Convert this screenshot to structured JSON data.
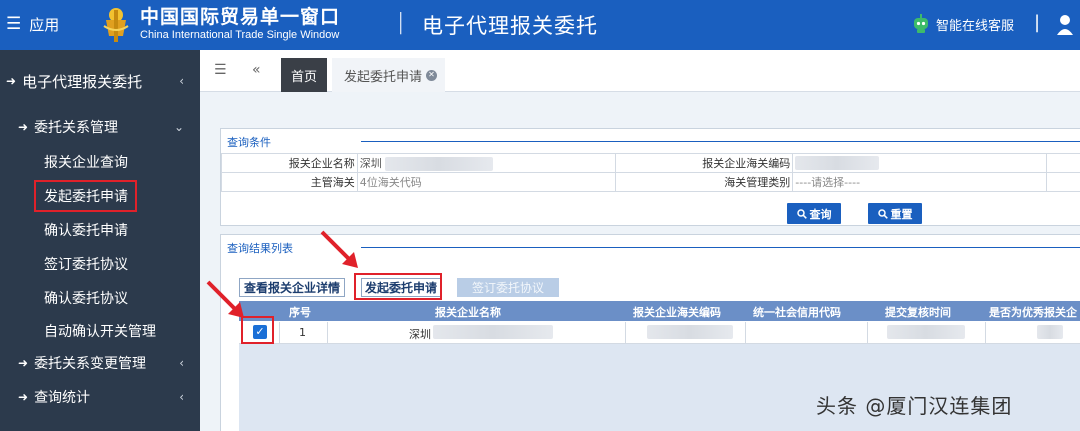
{
  "header": {
    "menu_label": "应用",
    "brand_cn": "中国国际贸易单一窗口",
    "brand_en": "China International Trade Single Window",
    "separator": "|",
    "subsystem": "电子代理报关委托",
    "service_label": "智能在线客服",
    "separator2": "|",
    "colors": {
      "bar": "#1a5fbf",
      "service_icon": "#3dbb6a"
    }
  },
  "sidebar": {
    "top": {
      "label": "电子代理报关委托",
      "icon": "sign-in-icon"
    },
    "group1": {
      "label": "委托关系管理",
      "icon": "sign-in-icon"
    },
    "subitems": [
      "报关企业查询",
      "发起委托申请",
      "确认委托申请",
      "签订委托协议",
      "确认委托协议",
      "自动确认开关管理"
    ],
    "group2": {
      "label": "委托关系变更管理",
      "icon": "sign-in-icon"
    },
    "group3": {
      "label": "查询统计",
      "icon": "sign-in-icon"
    }
  },
  "tabs": {
    "home": "首页",
    "active": "发起委托申请"
  },
  "query": {
    "legend": "查询条件",
    "fields": {
      "company_name_label": "报关企业名称",
      "company_name_value": "深圳",
      "customs_code_label": "报关企业海关编码",
      "customs_label": "主管海关",
      "customs_placeholder": "4位海关代码",
      "category_label": "海关管理类别",
      "category_value": "----请选择----"
    },
    "search_button": "查询",
    "reset_button": "重置"
  },
  "results": {
    "legend": "查询结果列表",
    "buttons": {
      "detail": "查看报关企业详情",
      "apply": "发起委托申请",
      "sign": "签订委托协议"
    },
    "columns": [
      "序号",
      "报关企业名称",
      "报关企业海关编码",
      "统一社会信用代码",
      "提交复核时间",
      "是否为优秀报关企"
    ],
    "rows": [
      {
        "checked": true,
        "index": "1",
        "company": "深圳"
      }
    ]
  },
  "annotation_color": "#e0212a",
  "watermark": "头条 @厦门汉连集团"
}
